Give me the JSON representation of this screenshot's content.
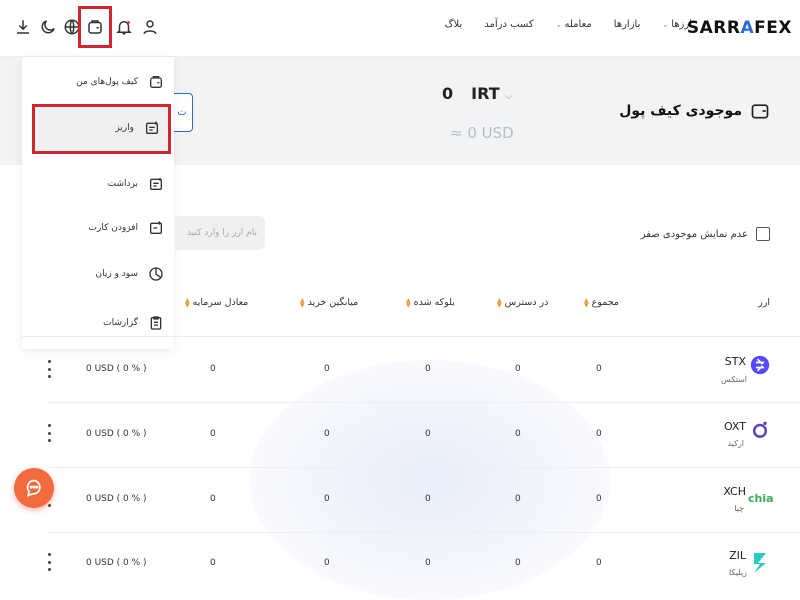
{
  "header": {
    "logo": "SARRAFEX",
    "nav": [
      {
        "label": "ارزها",
        "has_dropdown": true
      },
      {
        "label": "بازارها",
        "has_dropdown": false
      },
      {
        "label": "معامله",
        "has_dropdown": true
      },
      {
        "label": "کسب درآمد",
        "has_dropdown": false
      },
      {
        "label": "بلاگ",
        "has_dropdown": false
      }
    ],
    "icons": [
      "download-icon",
      "moon-icon",
      "globe-icon",
      "wallet-icon",
      "bell-icon",
      "user-icon"
    ]
  },
  "wallet_summary": {
    "title": "موجودی کیف پول",
    "irt_value": "0",
    "irt_currency": "IRT",
    "usd_approx": "≈ 0 USD"
  },
  "dropdown_menu": {
    "items": [
      {
        "label": "کیف پول‌های من",
        "icon": "wallet-icon"
      },
      {
        "label": "واریز",
        "icon": "deposit-icon",
        "highlighted": true
      },
      {
        "label": "برداشت",
        "icon": "withdraw-icon"
      },
      {
        "label": "افزودن کارت",
        "icon": "add-card-icon"
      },
      {
        "label": "سود و زیان",
        "icon": "pie-chart-icon"
      },
      {
        "label": "گزارشات",
        "icon": "report-icon"
      }
    ]
  },
  "filters": {
    "search_placeholder": "نام ارز را وارد کنید",
    "hide_zero_label": "عدم نمایش موجودی صفر"
  },
  "table": {
    "headers": {
      "asset": "ارز",
      "total": "مجموع",
      "available": "در دسترس",
      "blocked": "بلوکه شده",
      "avg_buy": "میانگین خرید",
      "equity": "معادل سرمایه"
    },
    "rows": [
      {
        "symbol": "STX",
        "name": "استکس",
        "total": "0",
        "available": "0",
        "blocked": "0",
        "avg_buy": "0",
        "equity": "0",
        "usd": "0 USD ( 0 % )"
      },
      {
        "symbol": "OXT",
        "name": "ارکید",
        "total": "0",
        "available": "0",
        "blocked": "0",
        "avg_buy": "0",
        "equity": "0",
        "usd": "0 USD ( 0 % )"
      },
      {
        "symbol": "XCH",
        "name": "چیا",
        "total": "0",
        "available": "0",
        "blocked": "0",
        "avg_buy": "0",
        "equity": "0",
        "usd": "0 USD ( 0 % )"
      },
      {
        "symbol": "ZIL",
        "name": "زیلیکا",
        "total": "0",
        "available": "0",
        "blocked": "0",
        "avg_buy": "0",
        "equity": "0",
        "usd": "0 USD ( 0 % )"
      }
    ]
  },
  "colors": {
    "accent": "#2f6bd6",
    "highlight": "#d0262f",
    "sort": "#e89a2c",
    "chat": "#f26a3d"
  }
}
